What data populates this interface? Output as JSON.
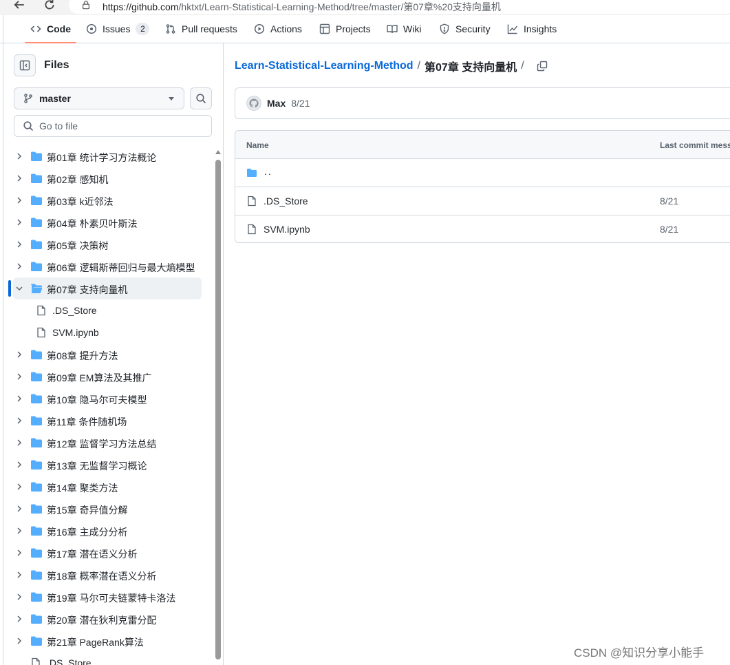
{
  "browser": {
    "url_host": "https://github.com",
    "url_path": "/hktxt/Learn-Statistical-Learning-Method/tree/master/第07章%20支持向量机"
  },
  "repo_nav": {
    "tabs": [
      {
        "label": "Code",
        "icon": "code-icon",
        "selected": true
      },
      {
        "label": "Issues",
        "icon": "issue-opened-icon",
        "count": "2"
      },
      {
        "label": "Pull requests",
        "icon": "git-pull-request-icon"
      },
      {
        "label": "Actions",
        "icon": "play-icon"
      },
      {
        "label": "Projects",
        "icon": "table-icon"
      },
      {
        "label": "Wiki",
        "icon": "book-icon"
      },
      {
        "label": "Security",
        "icon": "shield-icon"
      },
      {
        "label": "Insights",
        "icon": "graph-icon"
      }
    ]
  },
  "sidebar": {
    "title": "Files",
    "branch": "master",
    "goto_placeholder": "Go to file",
    "tree": [
      {
        "label": "第01章 统计学习方法概论",
        "type": "folder"
      },
      {
        "label": "第02章 感知机",
        "type": "folder"
      },
      {
        "label": "第03章 k近邻法",
        "type": "folder"
      },
      {
        "label": "第04章 朴素贝叶斯法",
        "type": "folder"
      },
      {
        "label": "第05章 决策树",
        "type": "folder"
      },
      {
        "label": "第06章 逻辑斯蒂回归与最大熵模型",
        "type": "folder"
      },
      {
        "label": "第07章 支持向量机",
        "type": "folder-open",
        "active": true
      },
      {
        "label": ".DS_Store",
        "type": "file",
        "child": true
      },
      {
        "label": "SVM.ipynb",
        "type": "file",
        "child": true
      },
      {
        "label": "第08章 提升方法",
        "type": "folder"
      },
      {
        "label": "第09章 EM算法及其推广",
        "type": "folder"
      },
      {
        "label": "第10章 隐马尔可夫模型",
        "type": "folder"
      },
      {
        "label": "第11章 条件随机场",
        "type": "folder"
      },
      {
        "label": "第12章 监督学习方法总结",
        "type": "folder"
      },
      {
        "label": "第13章 无监督学习概论",
        "type": "folder"
      },
      {
        "label": "第14章 聚类方法",
        "type": "folder"
      },
      {
        "label": "第15章 奇异值分解",
        "type": "folder"
      },
      {
        "label": "第16章 主成分分析",
        "type": "folder"
      },
      {
        "label": "第17章 潜在语义分析",
        "type": "folder"
      },
      {
        "label": "第18章 概率潜在语义分析",
        "type": "folder"
      },
      {
        "label": "第19章 马尔可夫链蒙特卡洛法",
        "type": "folder"
      },
      {
        "label": "第20章 潜在狄利克雷分配",
        "type": "folder"
      },
      {
        "label": "第21章 PageRank算法",
        "type": "folder"
      },
      {
        "label": ".DS_Store",
        "type": "file-root"
      }
    ]
  },
  "main": {
    "breadcrumb": {
      "repo": "Learn-Statistical-Learning-Method",
      "sep1": "/",
      "folder": "第07章 支持向量机",
      "sep2": "/"
    },
    "commit": {
      "author": "Max",
      "date": "8/21"
    },
    "table": {
      "col_name": "Name",
      "col_commit": "Last commit messa",
      "parent_link": "..",
      "rows": [
        {
          "name": ".DS_Store",
          "date": "8/21"
        },
        {
          "name": "SVM.ipynb",
          "date": "8/21"
        }
      ]
    }
  },
  "watermark": "CSDN @知识分享小能手",
  "colors": {
    "accent": "#0969da",
    "folder": "#54aeff",
    "selected_tab": "#fd8c73"
  }
}
